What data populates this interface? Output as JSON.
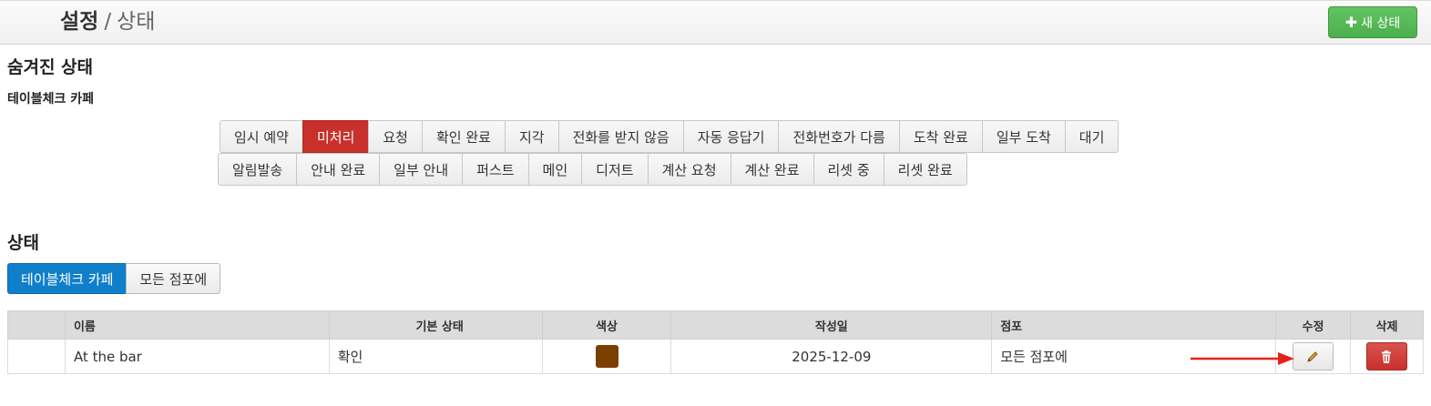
{
  "header": {
    "breadcrumb_root": "설정",
    "breadcrumb_sep": "/",
    "breadcrumb_current": "상태",
    "new_button_icon": "plus-icon",
    "new_button_label": "새 상태",
    "new_button_color": "#5cb85c"
  },
  "hidden_section": {
    "title": "숨겨진 상태",
    "store_name": "테이블체크 카페",
    "row1": [
      "임시 예약",
      "미처리",
      "요청",
      "확인 완료",
      "지각",
      "전화를 받지 않음",
      "자동 응답기",
      "전화번호가 다름",
      "도착 완료",
      "일부 도착",
      "대기"
    ],
    "row2": [
      "알림발송",
      "안내 완료",
      "일부 안내",
      "퍼스트",
      "메인",
      "디저트",
      "계산 요청",
      "계산 완료",
      "리셋 중",
      "리셋 완료"
    ],
    "active_label": "미처리",
    "active_color": "#c9302c"
  },
  "status_section": {
    "title": "상태",
    "scope_tabs": [
      "테이블체크 카페",
      "모든 점포에"
    ],
    "active_scope": "테이블체크 카페",
    "active_color": "#0f7fcc"
  },
  "table": {
    "headers": {
      "name": "이름",
      "base": "기본 상태",
      "color": "색상",
      "date": "작성일",
      "store": "점포",
      "edit": "수정",
      "delete": "삭제"
    },
    "rows": [
      {
        "name": "At the bar",
        "base": "확인",
        "color": "#7b3f00",
        "date": "2025-12-09",
        "store": "모든 점포에",
        "edit_icon": "pencil-icon",
        "delete_icon": "trash-icon"
      }
    ]
  },
  "annotation": {
    "arrow_color": "#e8201a",
    "arrow_target": "edit-button"
  }
}
